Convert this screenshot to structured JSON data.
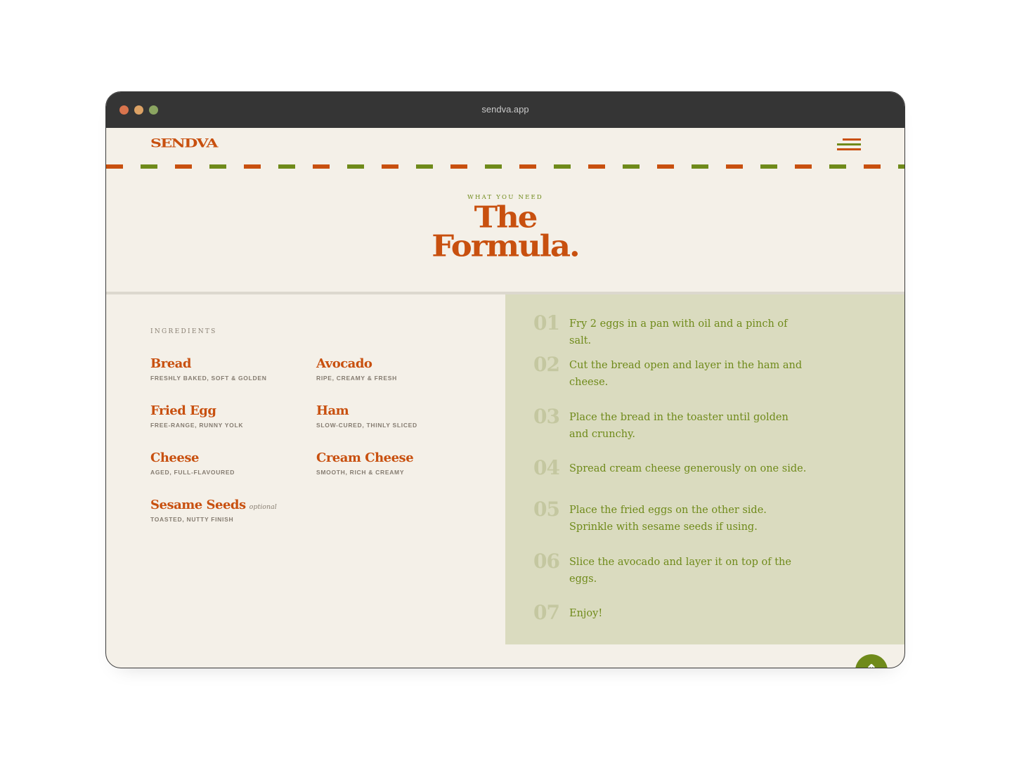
{
  "browser": {
    "url": "sendva.app"
  },
  "colors": {
    "accent": "#c8500f",
    "green": "#6f8a1a",
    "window_bg": "#f4f0e8",
    "steps_bg": "#dadbbf",
    "titlebar_bg": "#353535",
    "dot_red": "#d9744d",
    "dot_yellow": "#dca265",
    "dot_green": "#8ba561"
  },
  "header": {
    "logo": "SENDVA",
    "menu_icon": "hamburger-menu-icon"
  },
  "hero": {
    "eyebrow": "WHAT YOU NEED",
    "title_line1": "The",
    "title_line2": "Formula."
  },
  "ingredients": {
    "label": "INGREDIENTS",
    "items": [
      {
        "name": "Bread",
        "desc": "FRESHLY BAKED, SOFT & GOLDEN"
      },
      {
        "name": "Avocado",
        "desc": "RIPE, CREAMY & FRESH"
      },
      {
        "name": "Fried Egg",
        "desc": "FREE-RANGE, RUNNY YOLK"
      },
      {
        "name": "Ham",
        "desc": "SLOW-CURED, THINLY SLICED"
      },
      {
        "name": "Cheese",
        "desc": "AGED, FULL-FLAVOURED"
      },
      {
        "name": "Cream Cheese",
        "desc": "SMOOTH, RICH & CREAMY"
      },
      {
        "name": "Sesame Seeds",
        "desc": "TOASTED, NUTTY FINISH",
        "note": "optional"
      }
    ]
  },
  "steps": [
    {
      "num": "01",
      "text": "Fry 2 eggs in a pan with oil and a pinch of salt."
    },
    {
      "num": "02",
      "text": "Cut the bread open and layer in the ham and cheese."
    },
    {
      "num": "03",
      "text": "Place the bread in the toaster until golden and crunchy."
    },
    {
      "num": "04",
      "text": "Spread cream cheese generously on one side."
    },
    {
      "num": "05",
      "text": "Place the fried eggs on the other side. Sprinkle with sesame seeds if using."
    },
    {
      "num": "06",
      "text": "Slice the avocado and layer it on top of the eggs."
    },
    {
      "num": "07",
      "text": "Enjoy!"
    }
  ],
  "scroll_top": {
    "icon": "arrow-up-icon",
    "glyph": "↑"
  }
}
